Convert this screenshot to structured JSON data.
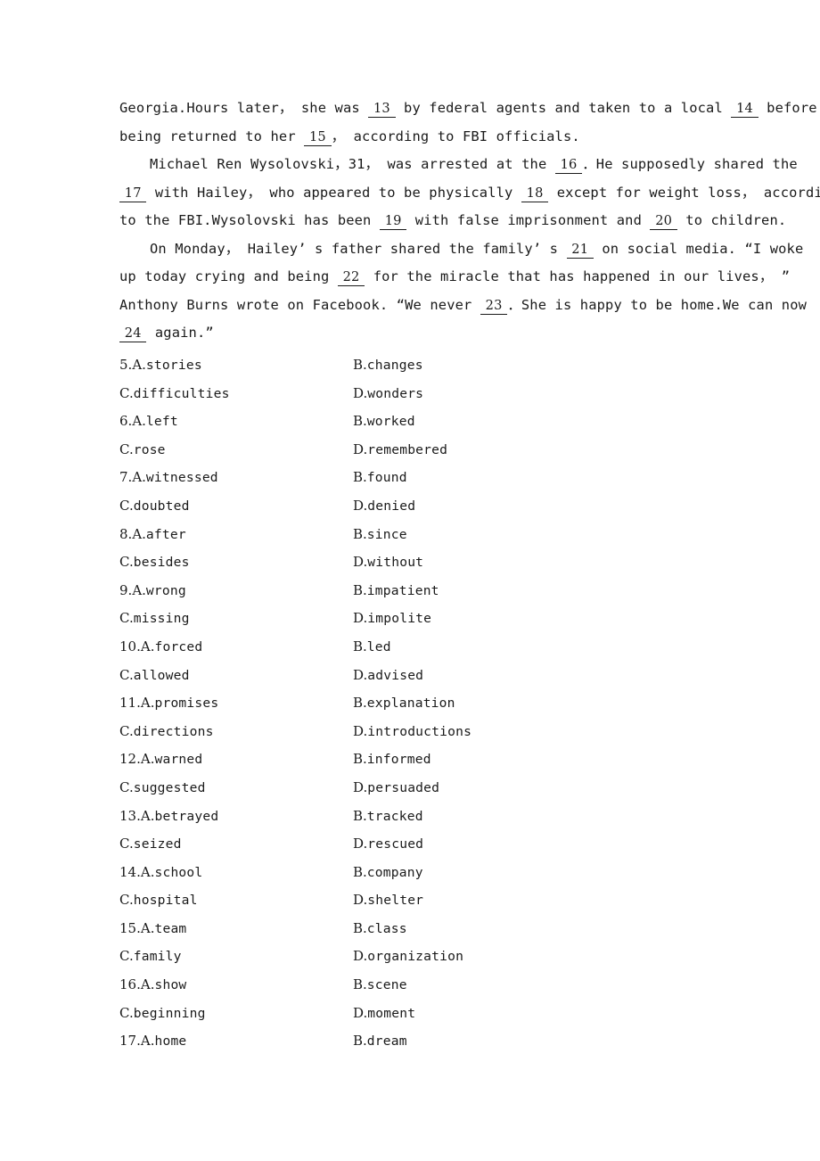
{
  "document": {
    "type": "english-cloze-exercise-page",
    "passage": {
      "lines": [
        [
          {
            "t": "text",
            "v": "Georgia.Hours later， she was "
          },
          {
            "t": "blank",
            "v": "13"
          },
          {
            "t": "text",
            "v": " by federal agents and taken to a local "
          },
          {
            "t": "blank",
            "v": "14"
          },
          {
            "t": "text",
            "v": " before"
          }
        ],
        [
          {
            "t": "text",
            "v": "being returned to her "
          },
          {
            "t": "blank",
            "v": "15"
          },
          {
            "t": "text",
            "v": "， according to FBI officials."
          }
        ],
        [
          {
            "t": "indent",
            "v": ""
          },
          {
            "t": "text",
            "v": "Michael Ren Wysolovski，31， was arrested at the "
          },
          {
            "t": "blank",
            "v": "16"
          },
          {
            "t": "text",
            "v": "．He supposedly shared the"
          }
        ],
        [
          {
            "t": "blank",
            "v": "17"
          },
          {
            "t": "text",
            "v": " with Hailey， who appeared to be physically "
          },
          {
            "t": "blank",
            "v": "18"
          },
          {
            "t": "text",
            "v": " except for weight loss， according"
          }
        ],
        [
          {
            "t": "text",
            "v": "to the FBI.Wysolovski has been "
          },
          {
            "t": "blank",
            "v": "19"
          },
          {
            "t": "text",
            "v": " with false imprisonment and "
          },
          {
            "t": "blank",
            "v": "20"
          },
          {
            "t": "text",
            "v": " to children."
          }
        ],
        [
          {
            "t": "indent",
            "v": ""
          },
          {
            "t": "text",
            "v": "On Monday， Hailey’ s father shared the family’ s "
          },
          {
            "t": "blank",
            "v": "21"
          },
          {
            "t": "text",
            "v": " on social media. “I woke"
          }
        ],
        [
          {
            "t": "text",
            "v": "up today crying and being "
          },
          {
            "t": "blank",
            "v": "22"
          },
          {
            "t": "text",
            "v": " for the miracle that has happened in our lives， ”"
          }
        ],
        [
          {
            "t": "text",
            "v": "Anthony Burns wrote on Facebook. “We never "
          },
          {
            "t": "blank",
            "v": "23"
          },
          {
            "t": "text",
            "v": "．She is happy to be home.We can now"
          }
        ],
        [
          {
            "t": "blank",
            "v": "24"
          },
          {
            "t": "text",
            "v": " again.”"
          }
        ]
      ]
    },
    "options": [
      {
        "number": "5.",
        "a": "stories",
        "b": "changes",
        "c": "difficulties",
        "d": "wonders"
      },
      {
        "number": "6.",
        "a": "left",
        "b": "worked",
        "c": "rose",
        "d": "remembered"
      },
      {
        "number": "7.",
        "a": "witnessed",
        "b": "found",
        "c": "doubted",
        "d": "denied"
      },
      {
        "number": "8.",
        "a": "after",
        "b": "since",
        "c": "besides",
        "d": "without"
      },
      {
        "number": "9.",
        "a": "wrong",
        "b": "impatient",
        "c": "missing",
        "d": "impolite"
      },
      {
        "number": "10.",
        "a": "forced",
        "b": "led",
        "c": "allowed",
        "d": "advised"
      },
      {
        "number": "11.",
        "a": "promises",
        "b": "explanation",
        "c": "directions",
        "d": "introductions"
      },
      {
        "number": "12.",
        "a": "warned",
        "b": "informed",
        "c": "suggested",
        "d": "persuaded"
      },
      {
        "number": "13.",
        "a": "betrayed",
        "b": "tracked",
        "c": "seized",
        "d": "rescued"
      },
      {
        "number": "14.",
        "a": "school",
        "b": "company",
        "c": "hospital",
        "d": "shelter"
      },
      {
        "number": "15.",
        "a": "team",
        "b": "class",
        "c": "family",
        "d": "organization"
      },
      {
        "number": "16.",
        "a": "show",
        "b": "scene",
        "c": "beginning",
        "d": "moment"
      },
      {
        "number": "17.",
        "a": "home",
        "b": "dream",
        "c": "",
        "d": ""
      }
    ],
    "option_letters": {
      "a": "A.",
      "b": "B.",
      "c": "C.",
      "d": "D."
    },
    "colors": {
      "text": "#1a1a1a",
      "background": "#ffffff"
    }
  }
}
